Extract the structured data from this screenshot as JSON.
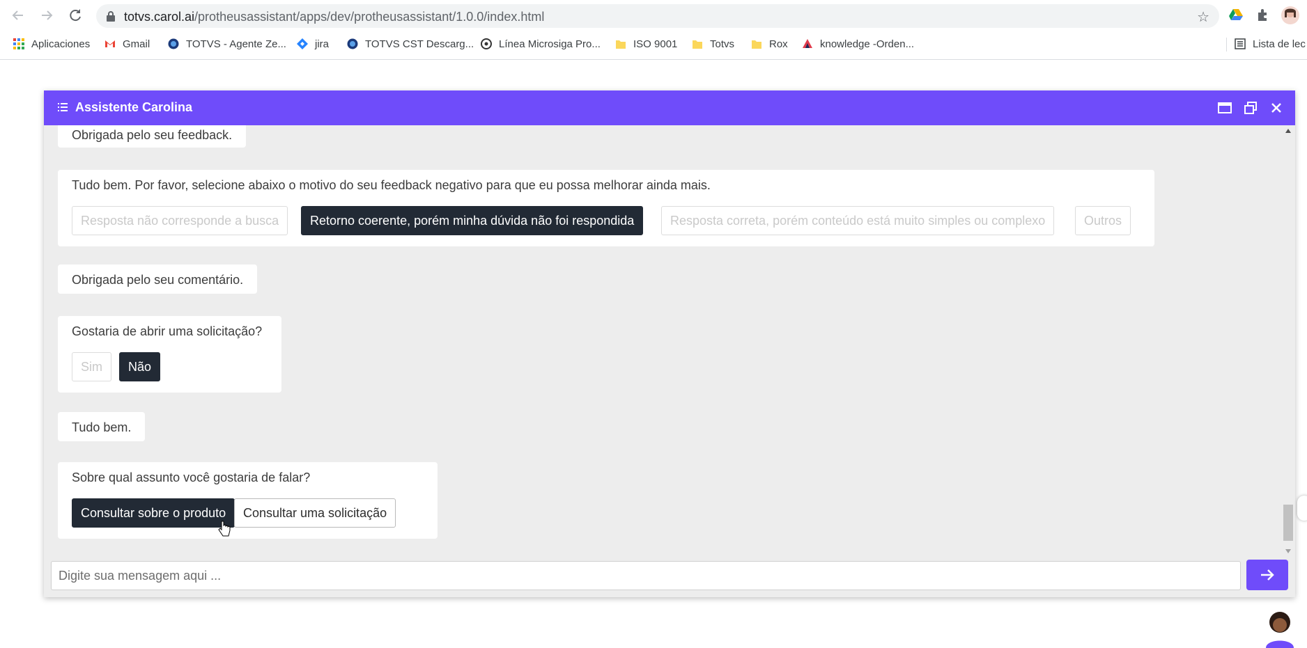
{
  "browser": {
    "url_host": "totvs.carol.ai",
    "url_path": "/protheusassistant/apps/dev/protheusassistant/1.0.0/index.html",
    "bookmarks": [
      {
        "label": "Aplicaciones",
        "icon": "apps-grid-icon"
      },
      {
        "label": "Gmail",
        "icon": "gmail-icon"
      },
      {
        "label": "TOTVS - Agente Ze...",
        "icon": "globe-icon"
      },
      {
        "label": "jira",
        "icon": "jira-icon"
      },
      {
        "label": "TOTVS CST Descarg...",
        "icon": "globe-icon"
      },
      {
        "label": "Línea Microsiga Pro...",
        "icon": "link-icon"
      },
      {
        "label": "ISO 9001",
        "icon": "folder-icon"
      },
      {
        "label": "Totvs",
        "icon": "folder-icon"
      },
      {
        "label": "Rox",
        "icon": "folder-icon"
      },
      {
        "label": "knowledge -Orden...",
        "icon": "knowledge-icon"
      },
      {
        "label": "Lista de lec",
        "icon": "reading-list-icon"
      }
    ]
  },
  "chat": {
    "title": "Assistente Carolina",
    "accent_color": "#6f4cfa",
    "messages": {
      "feedback_thanks": "Obrigada pelo seu feedback.",
      "reason_prompt": "Tudo bem. Por favor, selecione abaixo o motivo do seu feedback negativo para que eu possa melhorar ainda mais.",
      "reason_options": [
        "Resposta não corresponde a busca",
        "Retorno coerente, porém minha dúvida não foi respondida",
        "Resposta correta, porém conteúdo está muito simples ou complexo",
        "Outros"
      ],
      "comment_thanks": "Obrigada pelo seu comentário.",
      "ticket_prompt": "Gostaria de abrir uma solicitação?",
      "ticket_options": [
        "Sim",
        "Não"
      ],
      "ok": "Tudo bem.",
      "topic_prompt": "Sobre qual assunto você gostaria de falar?",
      "topic_options": [
        "Consultar sobre o produto",
        "Consultar uma solicitação"
      ]
    },
    "input_placeholder": "Digite sua mensagem aqui ..."
  }
}
